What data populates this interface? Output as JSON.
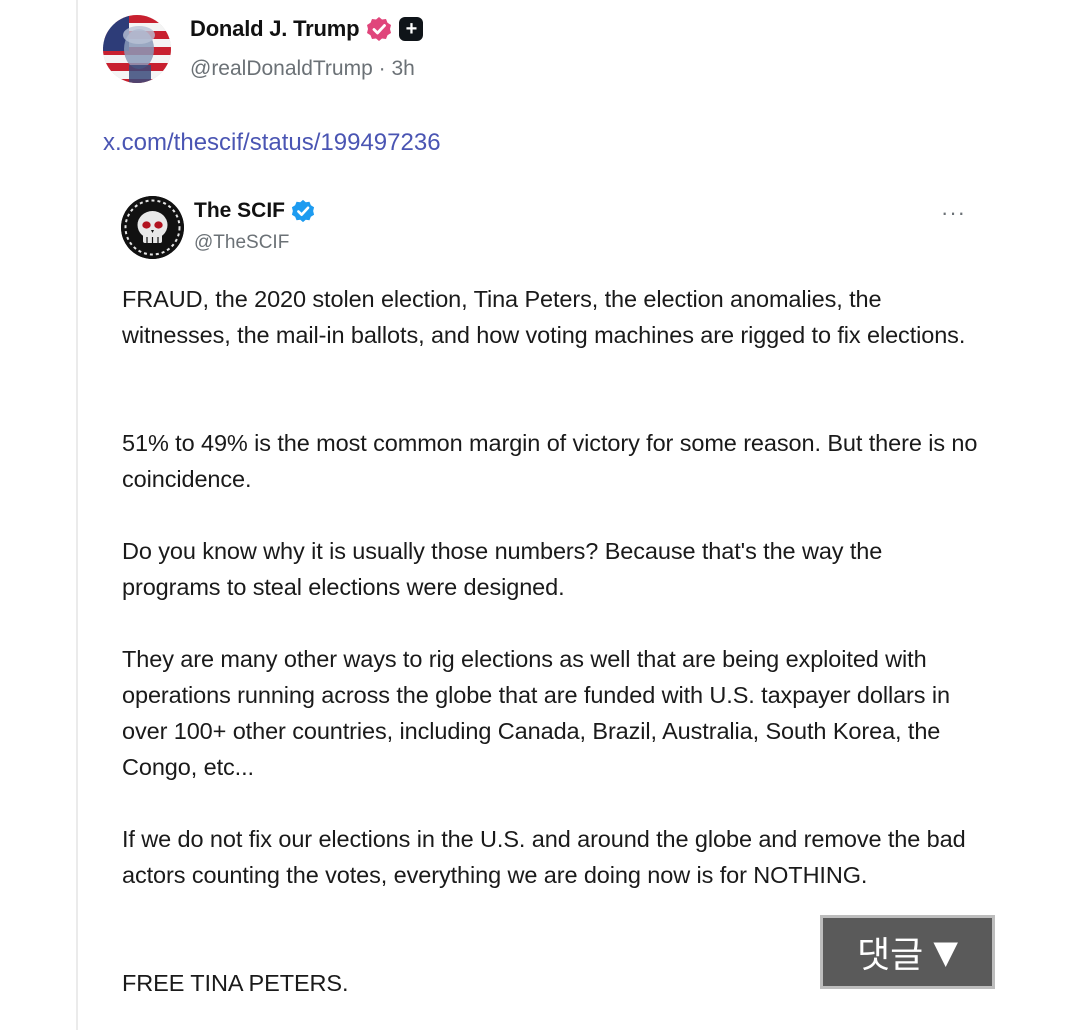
{
  "post": {
    "author_name": "Donald J. Trump",
    "handle_time": "@realDonaldTrump · 3h",
    "link_text": "x.com/thescif/status/199497236",
    "badge_square_symbol": "+",
    "badge_pink_color": "#e0457b",
    "link_color": "#4a55b3"
  },
  "quote": {
    "name": "The SCIF",
    "handle": "@TheSCIF",
    "more_label": "···",
    "verified_color": "#1d9bf0",
    "paragraphs": [
      "FRAUD, the 2020 stolen election, Tina Peters, the election anomalies, the witnesses, the mail-in ballots, and how voting machines are rigged to fix elections.",
      "51% to 49% is the most common margin of victory for some reason. But there is no coincidence.",
      "Do you know why it is usually those numbers? Because that's the way the programs to steal elections were designed.",
      "They are many other ways to rig elections as well that are being exploited with operations running across the globe that are funded with U.S. taxpayer dollars in over 100+ other countries, including Canada, Brazil, Australia, South Korea, the Congo, etc...",
      "If we do not fix our elections in the U.S. and around the globe and remove the bad actors counting the votes, everything we are doing now is for NOTHING.",
      "FREE TINA PETERS."
    ]
  },
  "overlay": {
    "comments_label": "댓글",
    "comments_icon": "▼"
  },
  "icons": {
    "main_avatar": "avatar-flag-portrait-icon",
    "quote_avatar": "skull-logo-icon",
    "verified_pink": "verified-badge-icon",
    "affiliate": "plus-badge-icon",
    "verified_blue": "verified-badge-icon",
    "more": "more-options-icon",
    "triangle": "triangle-down-icon"
  }
}
